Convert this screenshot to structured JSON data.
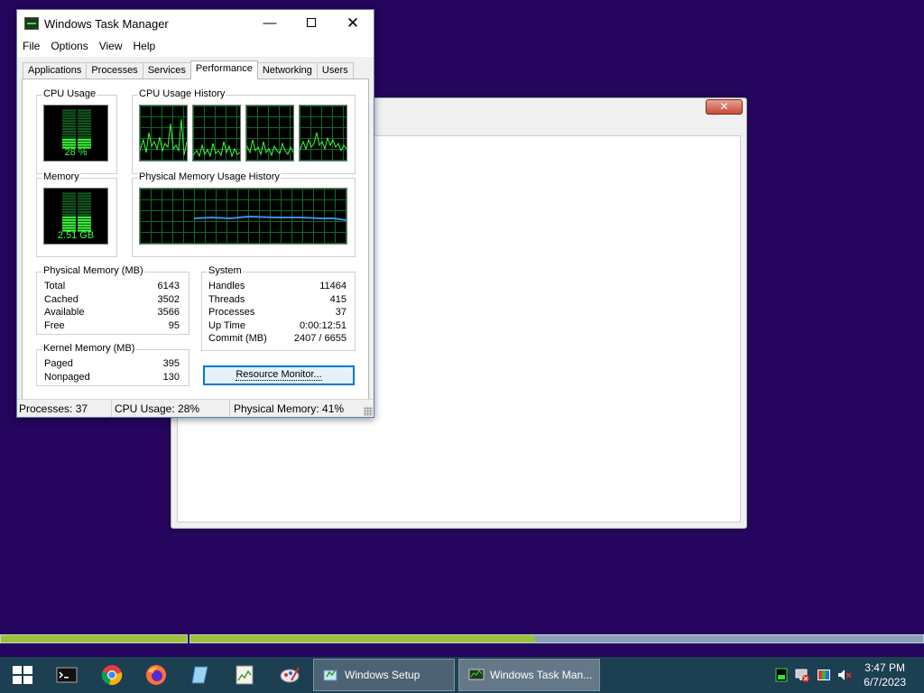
{
  "colors": {
    "desktop": "#25055d",
    "graph_line": "#3dff3d",
    "memory_line": "#3a8ee6",
    "progress_fill": "#9ac33a",
    "taskbar": "#1c3f52"
  },
  "setup_window": {
    "close_label": "✕"
  },
  "task_manager": {
    "title": "Windows Task Manager",
    "menu": [
      "File",
      "Options",
      "View",
      "Help"
    ],
    "tabs": [
      "Applications",
      "Processes",
      "Services",
      "Performance",
      "Networking",
      "Users"
    ],
    "active_tab": "Performance",
    "cpu_usage": {
      "label": "CPU Usage",
      "reading": "28 %",
      "level": 0.28
    },
    "cpu_history": {
      "label": "CPU Usage History"
    },
    "memory": {
      "label": "Memory",
      "reading": "2.51 GB",
      "level": 0.41
    },
    "memory_history": {
      "label": "Physical Memory Usage History"
    },
    "physical_memory": {
      "label": "Physical Memory (MB)",
      "rows": [
        {
          "k": "Total",
          "v": "6143"
        },
        {
          "k": "Cached",
          "v": "3502"
        },
        {
          "k": "Available",
          "v": "3566"
        },
        {
          "k": "Free",
          "v": "95"
        }
      ]
    },
    "kernel_memory": {
      "label": "Kernel Memory (MB)",
      "rows": [
        {
          "k": "Paged",
          "v": "395"
        },
        {
          "k": "Nonpaged",
          "v": "130"
        }
      ]
    },
    "system": {
      "label": "System",
      "rows": [
        {
          "k": "Handles",
          "v": "11464"
        },
        {
          "k": "Threads",
          "v": "415"
        },
        {
          "k": "Processes",
          "v": "37"
        },
        {
          "k": "Up Time",
          "v": "0:00:12:51"
        },
        {
          "k": "Commit (MB)",
          "v": "2407 / 6655"
        }
      ]
    },
    "resource_monitor_button": "Resource Monitor...",
    "status": {
      "processes": "Processes: 37",
      "cpu": "CPU Usage: 28%",
      "memory": "Physical Memory: 41%"
    }
  },
  "progress": {
    "segment1_fill": 1.0,
    "segment2_fill": 0.47
  },
  "taskbar": {
    "pinned": [
      "start-icon",
      "terminal-icon",
      "chrome-icon",
      "firefox-icon",
      "notepad-icon",
      "chart-icon",
      "paint-icon"
    ],
    "windows": [
      {
        "label": "Windows Setup",
        "icon": "setup-icon"
      },
      {
        "label": "Windows Task Man...",
        "icon": "task-manager-icon"
      }
    ],
    "time": "3:47 PM",
    "date": "6/7/2023"
  }
}
